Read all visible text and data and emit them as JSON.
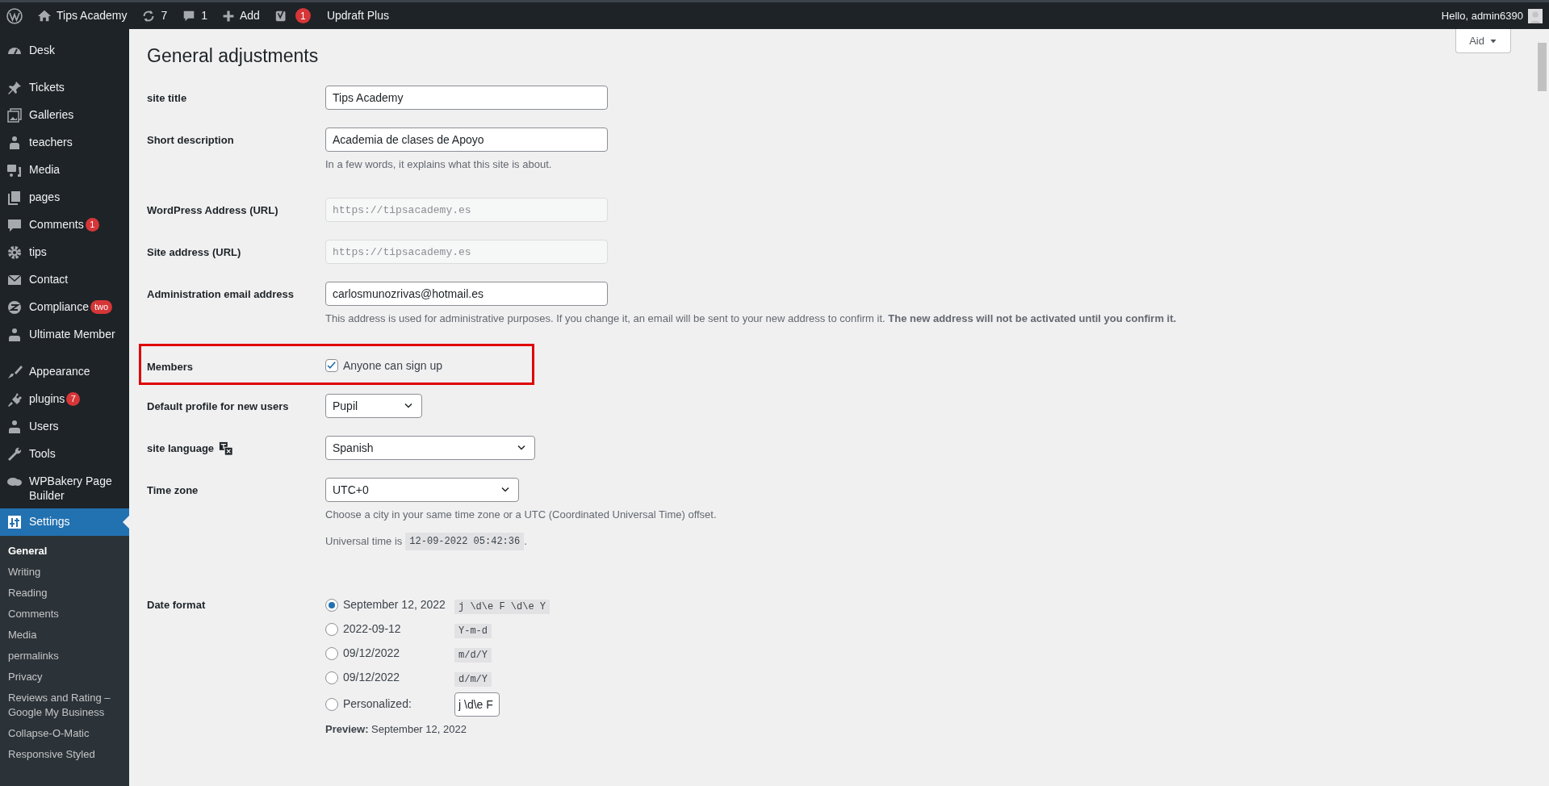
{
  "admin_bar": {
    "site_name": "Tips Academy",
    "updates": "7",
    "comments": "1",
    "add": "Add",
    "seo_badge": "1",
    "updraft": "Updraft Plus",
    "greeting": "Hello, admin6390"
  },
  "sidebar": {
    "items": [
      {
        "label": "Desk",
        "selected": false
      },
      {
        "label": "Tickets",
        "selected": false
      },
      {
        "label": "Galleries",
        "selected": false
      },
      {
        "label": "teachers",
        "selected": false
      },
      {
        "label": "Media",
        "selected": false
      },
      {
        "label": "pages",
        "selected": false
      },
      {
        "label": "Comments",
        "badge": "1",
        "selected": false
      },
      {
        "label": "tips",
        "selected": false
      },
      {
        "label": "Contact",
        "selected": false
      },
      {
        "label": "Compliance",
        "badge": "two",
        "selected": false
      },
      {
        "label": "Ultimate Member",
        "selected": false
      },
      {
        "label": "Appearance",
        "selected": false
      },
      {
        "label": "plugins",
        "badge": "7",
        "selected": false
      },
      {
        "label": "Users",
        "selected": false
      },
      {
        "label": "Tools",
        "selected": false
      },
      {
        "label": "WPBakery Page Builder",
        "selected": false
      },
      {
        "label": "Settings",
        "selected": true,
        "children": [
          {
            "label": "General",
            "selected": true
          },
          {
            "label": "Writing",
            "selected": false
          },
          {
            "label": "Reading",
            "selected": false
          },
          {
            "label": "Comments",
            "selected": false
          },
          {
            "label": "Media",
            "selected": false
          },
          {
            "label": "permalinks",
            "selected": false
          },
          {
            "label": "Privacy",
            "selected": false
          },
          {
            "label": "Reviews and Rating – Google My Business",
            "selected": false
          },
          {
            "label": "Collapse-O-Matic",
            "selected": false
          },
          {
            "label": "Responsive Styled",
            "selected": false
          }
        ]
      }
    ]
  },
  "help_button": "Aid",
  "page_title": "General adjustments",
  "rows": [
    {
      "kind": "text",
      "label": "site title",
      "value": "Tips Academy"
    },
    {
      "kind": "text",
      "label": "Short description",
      "value": "Academia de clases de Apoyo",
      "description": "In a few words, it explains what this site is about."
    },
    {
      "kind": "readonly",
      "label": "WordPress Address (URL)",
      "value": "https://tipsacademy.es"
    },
    {
      "kind": "readonly",
      "label": "Site address (URL)",
      "value": "https://tipsacademy.es"
    },
    {
      "kind": "text",
      "label": "Administration email address",
      "value": "carlosmunozrivas@hotmail.es",
      "description": "This address is used for administrative purposes. If you change it, an email will be sent to your new address to confirm it. **The new address will not be activated until you confirm it.**"
    },
    {
      "kind": "checkbox",
      "label": "Members",
      "option": "Anyone can sign up",
      "checked": true,
      "highlighted": true
    },
    {
      "kind": "select",
      "label": "Default profile for new users",
      "value": "Pupil"
    },
    {
      "kind": "wideselect",
      "label": "site language",
      "value": "Spanish",
      "label_icon": true
    },
    {
      "kind": "timezone",
      "label": "Time zone",
      "value": "UTC+0",
      "description": "Choose a city in your same time zone or a UTC (Coordinated Universal Time) offset.",
      "time_prefix": "Universal time is",
      "time": "12-09-2022 05:42:36",
      "time_suffix": "."
    },
    {
      "kind": "dateformat",
      "label": "Date format",
      "options": [
        {
          "label": "September 12, 2022",
          "code": "j \\d\\e F \\d\\e Y",
          "selected": true
        },
        {
          "label": "2022-09-12",
          "code": "Y-m-d",
          "selected": false
        },
        {
          "label": "09/12/2022",
          "code": "m/d/Y",
          "selected": false
        },
        {
          "label": "09/12/2022",
          "code": "d/m/Y",
          "selected": false
        },
        {
          "label": "Personalized:",
          "custom_value": "j \\d\\e F",
          "selected": false
        }
      ],
      "preview": "**Preview:** September 12, 2022"
    }
  ]
}
